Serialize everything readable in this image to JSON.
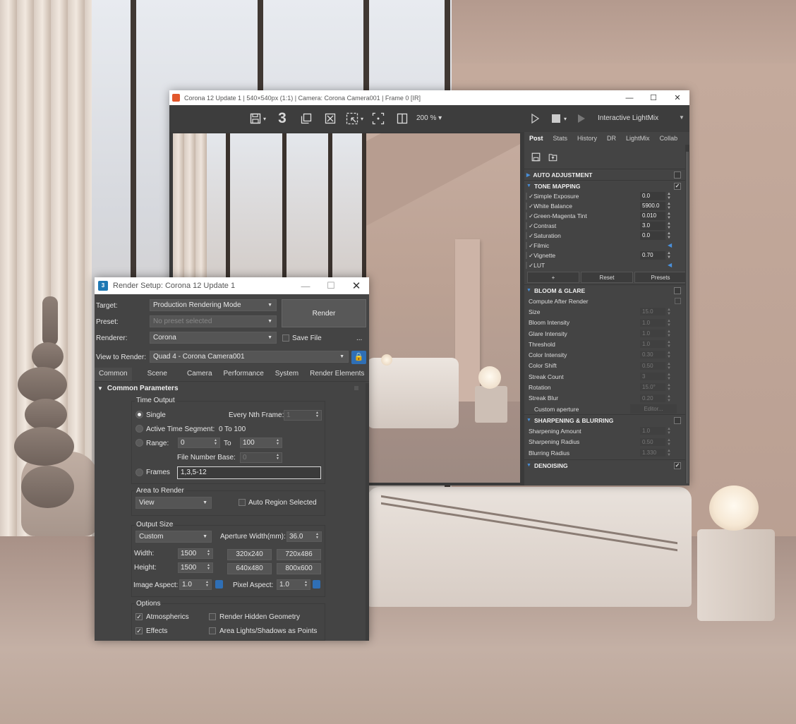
{
  "vfb": {
    "title": "Corona 12 Update 1 | 540×540px (1:1) | Camera: Corona Camera001 | Frame 0 [IR]",
    "toolbar": {
      "zoom": "200 %",
      "mode": "Interactive LightMix",
      "stats_number": "3"
    },
    "tabs": [
      "Post",
      "Stats",
      "History",
      "DR",
      "LightMix",
      "Collab"
    ],
    "sections": {
      "auto_adjustment": "AUTO ADJUSTMENT",
      "tone_mapping": "TONE MAPPING",
      "bloom_glare": "BLOOM & GLARE",
      "sharpening": "SHARPENING & BLURRING",
      "denoising": "DENOISING"
    },
    "tone_rows": [
      {
        "label": "✓Simple Exposure",
        "value": "0.0"
      },
      {
        "label": "✓White Balance",
        "value": "5900.0"
      },
      {
        "label": "✓Green-Magenta Tint",
        "value": "0.010"
      },
      {
        "label": "✓Contrast",
        "value": "3.0"
      },
      {
        "label": "✓Saturation",
        "value": "0.0"
      },
      {
        "label": "✓Filmic",
        "value": ""
      },
      {
        "label": "✓Vignette",
        "value": "0.70"
      },
      {
        "label": "✓LUT",
        "value": ""
      }
    ],
    "lut_buttons": {
      "add": "+",
      "reset": "Reset",
      "presets": "Presets"
    },
    "bloom_rows": [
      {
        "label": "Compute After Render",
        "value": ""
      },
      {
        "label": "Size",
        "value": "15.0"
      },
      {
        "label": "Bloom Intensity",
        "value": "1.0"
      },
      {
        "label": "Glare Intensity",
        "value": "1.0"
      },
      {
        "label": "Threshold",
        "value": "1.0"
      },
      {
        "label": "Color Intensity",
        "value": "0.30"
      },
      {
        "label": "Color Shift",
        "value": "0.50"
      },
      {
        "label": "Streak Count",
        "value": "3"
      },
      {
        "label": "Rotation",
        "value": "15.0°"
      },
      {
        "label": "Streak Blur",
        "value": "0.20"
      }
    ],
    "custom_aperture": "Custom aperture",
    "editor": "Editor...",
    "sharp_rows": [
      {
        "label": "Sharpening Amount",
        "value": "1.0"
      },
      {
        "label": "Sharpening Radius",
        "value": "0.50"
      },
      {
        "label": "Blurring Radius",
        "value": "1.330"
      }
    ]
  },
  "rs": {
    "title": "Render Setup: Corona 12 Update 1",
    "logo_text": "3",
    "target_label": "Target:",
    "target_value": "Production Rendering Mode",
    "preset_label": "Preset:",
    "preset_value": "No preset selected",
    "renderer_label": "Renderer:",
    "renderer_value": "Corona",
    "save_file": "Save File",
    "ellipsis": "...",
    "view_label": "View to Render:",
    "view_value": "Quad 4 - Corona Camera001",
    "render_button": "Render",
    "tabs": [
      "Common",
      "Scene",
      "Camera",
      "Performance",
      "System",
      "Render Elements"
    ],
    "common_params": "Common Parameters",
    "time_output": "Time Output",
    "single": "Single",
    "every_nth": "Every Nth Frame:",
    "every_nth_value": "1",
    "active_segment": "Active Time Segment:",
    "active_segment_value": "0 To 100",
    "range": "Range:",
    "range_from": "0",
    "range_to_label": "To",
    "range_to": "100",
    "file_number_base": "File Number Base:",
    "file_number_value": "0",
    "frames": "Frames",
    "frames_value": "1,3,5-12",
    "area_to_render": "Area to Render",
    "area_value": "View",
    "auto_region": "Auto Region Selected",
    "output_size": "Output Size",
    "output_preset": "Custom",
    "aperture_label": "Aperture Width(mm):",
    "aperture_value": "36.0",
    "width_label": "Width:",
    "width_value": "1500",
    "height_label": "Height:",
    "height_value": "1500",
    "presets": [
      "320x240",
      "720x486",
      "640x480",
      "800x600"
    ],
    "image_aspect_label": "Image Aspect:",
    "image_aspect_value": "1.0",
    "pixel_aspect_label": "Pixel Aspect:",
    "pixel_aspect_value": "1.0",
    "options": "Options",
    "atmospherics": "Atmospherics",
    "render_hidden": "Render Hidden Geometry",
    "effects": "Effects",
    "area_lights": "Area Lights/Shadows as Points"
  }
}
